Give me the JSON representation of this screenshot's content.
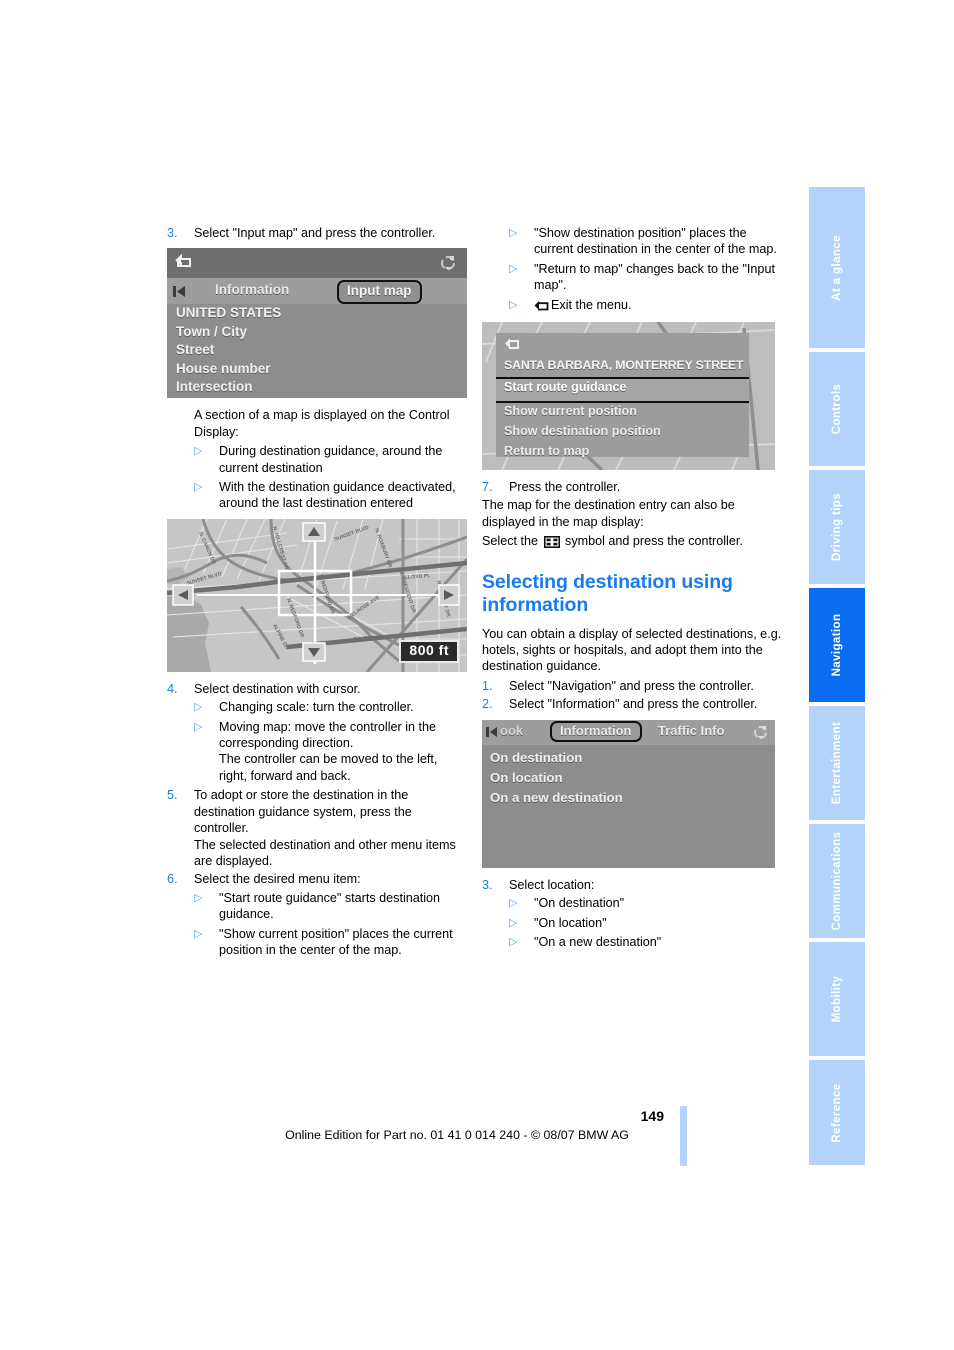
{
  "sidebar": {
    "tabs": [
      {
        "label": "At a glance",
        "active": false
      },
      {
        "label": "Controls",
        "active": false
      },
      {
        "label": "Driving tips",
        "active": false
      },
      {
        "label": "Navigation",
        "active": true
      },
      {
        "label": "Entertainment",
        "active": false
      },
      {
        "label": "Communications",
        "active": false
      },
      {
        "label": "Mobility",
        "active": false
      },
      {
        "label": "Reference",
        "active": false
      }
    ],
    "active_color": "#0a6cf0",
    "inactive_color": "#b3d3fb"
  },
  "left_column": {
    "step3": {
      "num": "3.",
      "text": "Select \"Input map\" and press the controller."
    },
    "screenshot_input_map": {
      "back_icon": "back-arrow-icon",
      "rotate_icon": "rotate-icon",
      "left_arrow_icon": "left-arrow-icon",
      "tab_inactive": "Information",
      "tab_selected": "Input map",
      "list": [
        "UNITED STATES",
        "Town / City",
        "Street",
        "House number",
        "Intersection"
      ]
    },
    "para_map_section": "A section of a map is displayed on the Control Display:",
    "bullets_map": [
      "During destination guidance, around the current destination",
      "With the destination guidance deactivated, around the last destination entered"
    ],
    "screenshot_map": {
      "scale_label": "800 ft",
      "up_arrow_icon": "up-arrow-icon",
      "down_arrow_icon": "down-arrow-icon",
      "left_arrow_icon": "left-arrow-icon",
      "right_arrow_icon": "right-arrow-icon",
      "street_labels": [
        "N. CANON DR",
        "N. HILLCREST DR",
        "SUNSET BLVD",
        "N. ROXBURY DR",
        "SUNSET BLVD",
        "N. BEDFORD DR",
        "N. CRESCENT DR",
        "LLOYD PL",
        "ALPINE DR",
        "BURTON WAY",
        "MELROSE AVE",
        "N. DOHENY DR"
      ]
    },
    "step4": {
      "num": "4.",
      "text": "Select destination with cursor.",
      "bullets": [
        "Changing scale: turn the controller.",
        "Moving map: move the controller in the corresponding direction.\nThe controller can be moved to the left, right, forward and back."
      ]
    },
    "step5": {
      "num": "5.",
      "text": "To adopt or store the destination in the destination guidance system, press the controller.\nThe selected destination and other menu items are displayed."
    },
    "step6": {
      "num": "6.",
      "text": "Select the desired menu item:",
      "bullets": [
        "\"Start route guidance\" starts destination guidance.",
        "\"Show current position\" places the current position in the center of the map."
      ]
    }
  },
  "right_column": {
    "bullets_top": [
      "\"Show destination position\" places the current destination in the center of the map.",
      "\"Return to map\" changes back to the \"Input map\".",
      "Exit the menu."
    ],
    "exit_icon": "back-arrow-icon",
    "screenshot_route_menu": {
      "back_icon": "back-arrow-icon",
      "title": "SANTA BARBARA, MONTERREY STREET",
      "items": [
        "Start route guidance",
        "Show current position",
        "Show destination position",
        "Return to map"
      ],
      "selected_item": "Start route guidance"
    },
    "step7": {
      "num": "7.",
      "text": "Press the controller."
    },
    "para_map_display_1": "The map for the destination entry can also be displayed in the map display:",
    "para_map_display_2a": "Select the",
    "para_map_display_2b": "symbol and press the controller.",
    "map_symbol_icon": "map-cursor-icon",
    "heading": "Selecting destination using information",
    "intro": "You can obtain a display of selected destinations, e.g. hotels, sights or hospitals, and adopt them into the destination guidance.",
    "step1": {
      "num": "1.",
      "text": "Select \"Navigation\" and press the controller."
    },
    "step2": {
      "num": "2.",
      "text": "Select \"Information\" and press the controller."
    },
    "screenshot_information": {
      "left_arrow_icon": "left-arrow-icon",
      "rotate_icon": "rotate-icon",
      "tab_partial": "ook",
      "tab_selected": "Information",
      "tab_other": "Traffic Info",
      "list": [
        "On destination",
        "On location",
        "On a new destination"
      ]
    },
    "step3": {
      "num": "3.",
      "text": "Select location:",
      "bullets": [
        "\"On destination\"",
        "\"On location\"",
        "\"On a new destination\""
      ]
    }
  },
  "footer": {
    "page_number": "149",
    "text": "Online Edition for Part no. 01 41 0 014 240 - © 08/07 BMW AG"
  }
}
